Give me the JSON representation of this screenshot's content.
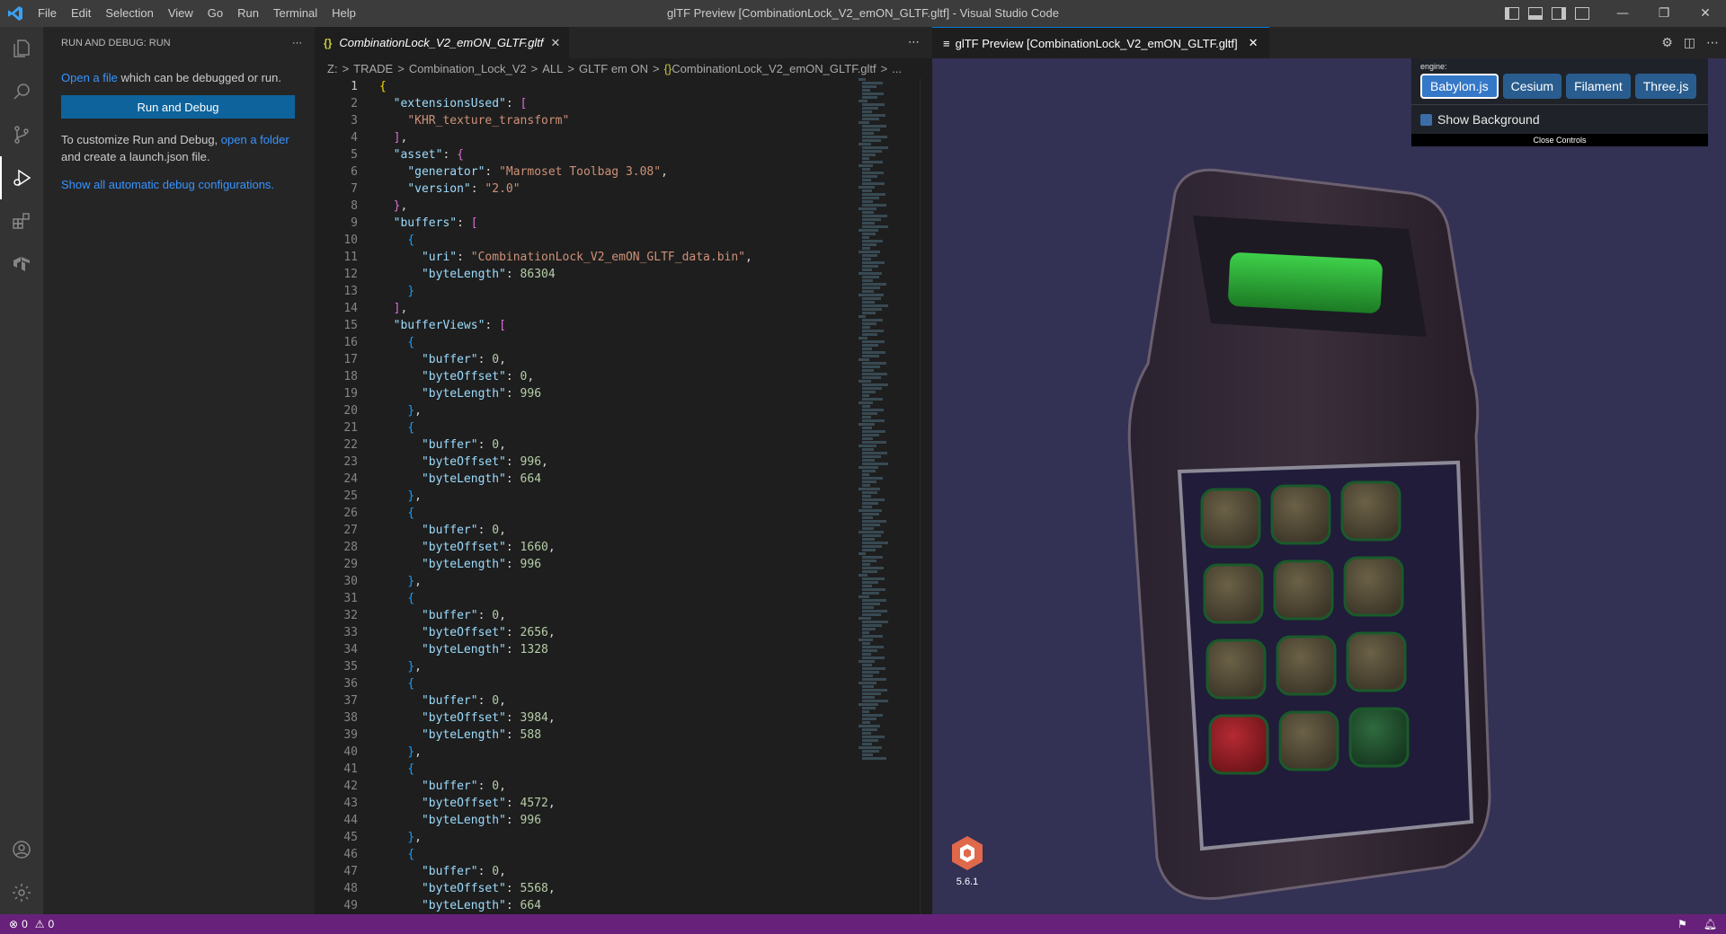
{
  "titlebar": {
    "title": "glTF Preview [CombinationLock_V2_emON_GLTF.gltf] - Visual Studio Code",
    "menu": [
      "File",
      "Edit",
      "Selection",
      "View",
      "Go",
      "Run",
      "Terminal",
      "Help"
    ]
  },
  "activity": {
    "items": [
      "explorer-icon",
      "search-icon",
      "source-control-icon",
      "run-debug-icon",
      "extensions-icon",
      "terraform-icon"
    ],
    "bottom": [
      "account-icon",
      "gear-icon"
    ]
  },
  "sidebar": {
    "header": "RUN AND DEBUG: RUN",
    "open_file_link": "Open a file",
    "open_file_text": " which can be debugged or run.",
    "run_button": "Run and Debug",
    "customize_text": "To customize Run and Debug, ",
    "open_folder_link": "open a folder",
    "customize_text2": " and create a launch.json file.",
    "show_all_link": "Show all automatic debug configurations."
  },
  "editor": {
    "tab_label": "CombinationLock_V2_emON_GLTF.gltf",
    "breadcrumb": [
      "Z:",
      "TRADE",
      "Combination_Lock_V2",
      "ALL",
      "GLTF em ON",
      "CombinationLock_V2_emON_GLTF.gltf",
      "..."
    ],
    "lines": [
      [
        [
          "b1",
          "{"
        ]
      ],
      [
        [
          "t",
          "  "
        ],
        [
          "k",
          "\"extensionsUsed\""
        ],
        [
          "t",
          ": "
        ],
        [
          "b2",
          "["
        ]
      ],
      [
        [
          "t",
          "    "
        ],
        [
          "s",
          "\"KHR_texture_transform\""
        ]
      ],
      [
        [
          "t",
          "  "
        ],
        [
          "b2",
          "]"
        ],
        [
          "t",
          ","
        ]
      ],
      [
        [
          "t",
          "  "
        ],
        [
          "k",
          "\"asset\""
        ],
        [
          "t",
          ": "
        ],
        [
          "b2",
          "{"
        ]
      ],
      [
        [
          "t",
          "    "
        ],
        [
          "k",
          "\"generator\""
        ],
        [
          "t",
          ": "
        ],
        [
          "s",
          "\"Marmoset Toolbag 3.08\""
        ],
        [
          "t",
          ","
        ]
      ],
      [
        [
          "t",
          "    "
        ],
        [
          "k",
          "\"version\""
        ],
        [
          "t",
          ": "
        ],
        [
          "s",
          "\"2.0\""
        ]
      ],
      [
        [
          "t",
          "  "
        ],
        [
          "b2",
          "}"
        ],
        [
          "t",
          ","
        ]
      ],
      [
        [
          "t",
          "  "
        ],
        [
          "k",
          "\"buffers\""
        ],
        [
          "t",
          ": "
        ],
        [
          "b2",
          "["
        ]
      ],
      [
        [
          "t",
          "    "
        ],
        [
          "b3",
          "{"
        ]
      ],
      [
        [
          "t",
          "      "
        ],
        [
          "k",
          "\"uri\""
        ],
        [
          "t",
          ": "
        ],
        [
          "s",
          "\"CombinationLock_V2_emON_GLTF_data.bin\""
        ],
        [
          "t",
          ","
        ]
      ],
      [
        [
          "t",
          "      "
        ],
        [
          "k",
          "\"byteLength\""
        ],
        [
          "t",
          ": "
        ],
        [
          "n",
          "86304"
        ]
      ],
      [
        [
          "t",
          "    "
        ],
        [
          "b3",
          "}"
        ]
      ],
      [
        [
          "t",
          "  "
        ],
        [
          "b2",
          "]"
        ],
        [
          "t",
          ","
        ]
      ],
      [
        [
          "t",
          "  "
        ],
        [
          "k",
          "\"bufferViews\""
        ],
        [
          "t",
          ": "
        ],
        [
          "b2",
          "["
        ]
      ],
      [
        [
          "t",
          "    "
        ],
        [
          "b3",
          "{"
        ]
      ],
      [
        [
          "t",
          "      "
        ],
        [
          "k",
          "\"buffer\""
        ],
        [
          "t",
          ": "
        ],
        [
          "n",
          "0"
        ],
        [
          "t",
          ","
        ]
      ],
      [
        [
          "t",
          "      "
        ],
        [
          "k",
          "\"byteOffset\""
        ],
        [
          "t",
          ": "
        ],
        [
          "n",
          "0"
        ],
        [
          "t",
          ","
        ]
      ],
      [
        [
          "t",
          "      "
        ],
        [
          "k",
          "\"byteLength\""
        ],
        [
          "t",
          ": "
        ],
        [
          "n",
          "996"
        ]
      ],
      [
        [
          "t",
          "    "
        ],
        [
          "b3",
          "}"
        ],
        [
          "t",
          ","
        ]
      ],
      [
        [
          "t",
          "    "
        ],
        [
          "b3",
          "{"
        ]
      ],
      [
        [
          "t",
          "      "
        ],
        [
          "k",
          "\"buffer\""
        ],
        [
          "t",
          ": "
        ],
        [
          "n",
          "0"
        ],
        [
          "t",
          ","
        ]
      ],
      [
        [
          "t",
          "      "
        ],
        [
          "k",
          "\"byteOffset\""
        ],
        [
          "t",
          ": "
        ],
        [
          "n",
          "996"
        ],
        [
          "t",
          ","
        ]
      ],
      [
        [
          "t",
          "      "
        ],
        [
          "k",
          "\"byteLength\""
        ],
        [
          "t",
          ": "
        ],
        [
          "n",
          "664"
        ]
      ],
      [
        [
          "t",
          "    "
        ],
        [
          "b3",
          "}"
        ],
        [
          "t",
          ","
        ]
      ],
      [
        [
          "t",
          "    "
        ],
        [
          "b3",
          "{"
        ]
      ],
      [
        [
          "t",
          "      "
        ],
        [
          "k",
          "\"buffer\""
        ],
        [
          "t",
          ": "
        ],
        [
          "n",
          "0"
        ],
        [
          "t",
          ","
        ]
      ],
      [
        [
          "t",
          "      "
        ],
        [
          "k",
          "\"byteOffset\""
        ],
        [
          "t",
          ": "
        ],
        [
          "n",
          "1660"
        ],
        [
          "t",
          ","
        ]
      ],
      [
        [
          "t",
          "      "
        ],
        [
          "k",
          "\"byteLength\""
        ],
        [
          "t",
          ": "
        ],
        [
          "n",
          "996"
        ]
      ],
      [
        [
          "t",
          "    "
        ],
        [
          "b3",
          "}"
        ],
        [
          "t",
          ","
        ]
      ],
      [
        [
          "t",
          "    "
        ],
        [
          "b3",
          "{"
        ]
      ],
      [
        [
          "t",
          "      "
        ],
        [
          "k",
          "\"buffer\""
        ],
        [
          "t",
          ": "
        ],
        [
          "n",
          "0"
        ],
        [
          "t",
          ","
        ]
      ],
      [
        [
          "t",
          "      "
        ],
        [
          "k",
          "\"byteOffset\""
        ],
        [
          "t",
          ": "
        ],
        [
          "n",
          "2656"
        ],
        [
          "t",
          ","
        ]
      ],
      [
        [
          "t",
          "      "
        ],
        [
          "k",
          "\"byteLength\""
        ],
        [
          "t",
          ": "
        ],
        [
          "n",
          "1328"
        ]
      ],
      [
        [
          "t",
          "    "
        ],
        [
          "b3",
          "}"
        ],
        [
          "t",
          ","
        ]
      ],
      [
        [
          "t",
          "    "
        ],
        [
          "b3",
          "{"
        ]
      ],
      [
        [
          "t",
          "      "
        ],
        [
          "k",
          "\"buffer\""
        ],
        [
          "t",
          ": "
        ],
        [
          "n",
          "0"
        ],
        [
          "t",
          ","
        ]
      ],
      [
        [
          "t",
          "      "
        ],
        [
          "k",
          "\"byteOffset\""
        ],
        [
          "t",
          ": "
        ],
        [
          "n",
          "3984"
        ],
        [
          "t",
          ","
        ]
      ],
      [
        [
          "t",
          "      "
        ],
        [
          "k",
          "\"byteLength\""
        ],
        [
          "t",
          ": "
        ],
        [
          "n",
          "588"
        ]
      ],
      [
        [
          "t",
          "    "
        ],
        [
          "b3",
          "}"
        ],
        [
          "t",
          ","
        ]
      ],
      [
        [
          "t",
          "    "
        ],
        [
          "b3",
          "{"
        ]
      ],
      [
        [
          "t",
          "      "
        ],
        [
          "k",
          "\"buffer\""
        ],
        [
          "t",
          ": "
        ],
        [
          "n",
          "0"
        ],
        [
          "t",
          ","
        ]
      ],
      [
        [
          "t",
          "      "
        ],
        [
          "k",
          "\"byteOffset\""
        ],
        [
          "t",
          ": "
        ],
        [
          "n",
          "4572"
        ],
        [
          "t",
          ","
        ]
      ],
      [
        [
          "t",
          "      "
        ],
        [
          "k",
          "\"byteLength\""
        ],
        [
          "t",
          ": "
        ],
        [
          "n",
          "996"
        ]
      ],
      [
        [
          "t",
          "    "
        ],
        [
          "b3",
          "}"
        ],
        [
          "t",
          ","
        ]
      ],
      [
        [
          "t",
          "    "
        ],
        [
          "b3",
          "{"
        ]
      ],
      [
        [
          "t",
          "      "
        ],
        [
          "k",
          "\"buffer\""
        ],
        [
          "t",
          ": "
        ],
        [
          "n",
          "0"
        ],
        [
          "t",
          ","
        ]
      ],
      [
        [
          "t",
          "      "
        ],
        [
          "k",
          "\"byteOffset\""
        ],
        [
          "t",
          ": "
        ],
        [
          "n",
          "5568"
        ],
        [
          "t",
          ","
        ]
      ],
      [
        [
          "t",
          "      "
        ],
        [
          "k",
          "\"byteLength\""
        ],
        [
          "t",
          ": "
        ],
        [
          "n",
          "664"
        ]
      ]
    ]
  },
  "preview": {
    "tab_label": "glTF Preview [CombinationLock_V2_emON_GLTF.gltf]",
    "engine_label": "engine:",
    "engines": [
      "Babylon.js",
      "Cesium",
      "Filament",
      "Three.js"
    ],
    "selected_engine": "Babylon.js",
    "show_background_label": "Show Background",
    "close_controls_label": "Close Controls",
    "babylon_version": "5.6.1"
  },
  "status": {
    "errors": "0",
    "warnings": "0"
  },
  "colors": {
    "statusbar": "#68217a",
    "accent": "#0e639c",
    "viewport_bg": "#333154"
  }
}
